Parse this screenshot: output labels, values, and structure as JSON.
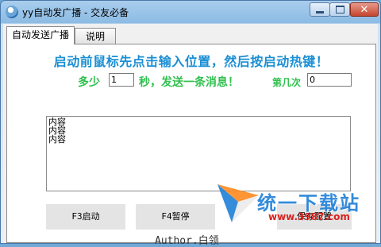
{
  "window": {
    "title": "yy自动发广播 - 交友必备",
    "close_glyph": "✕"
  },
  "tabs": [
    {
      "label": "自动发送广播",
      "active": true
    },
    {
      "label": "说明",
      "active": false
    }
  ],
  "panel": {
    "headline": "启动前鼠标先点击输入位置，然后按启动热键！",
    "label_duo": "多少",
    "seconds_value": "1",
    "label_miao": "秒，发送一条消息！",
    "label_dijici": "第几次",
    "count_value": "0",
    "message_lines": [
      "内容",
      "内容",
      "内容"
    ],
    "buttons": {
      "start": "F3启动",
      "pause": "F4暂停",
      "save": "保存配置"
    },
    "author": "Author.白领"
  },
  "watermark": {
    "brand": "统一下载站",
    "url": "www.3987.com"
  },
  "colors": {
    "headline": "#1a8fd4",
    "green_labels": "#2fc04e",
    "watermark_text": "#1f7fd6",
    "watermark_url": "#d9231f"
  }
}
